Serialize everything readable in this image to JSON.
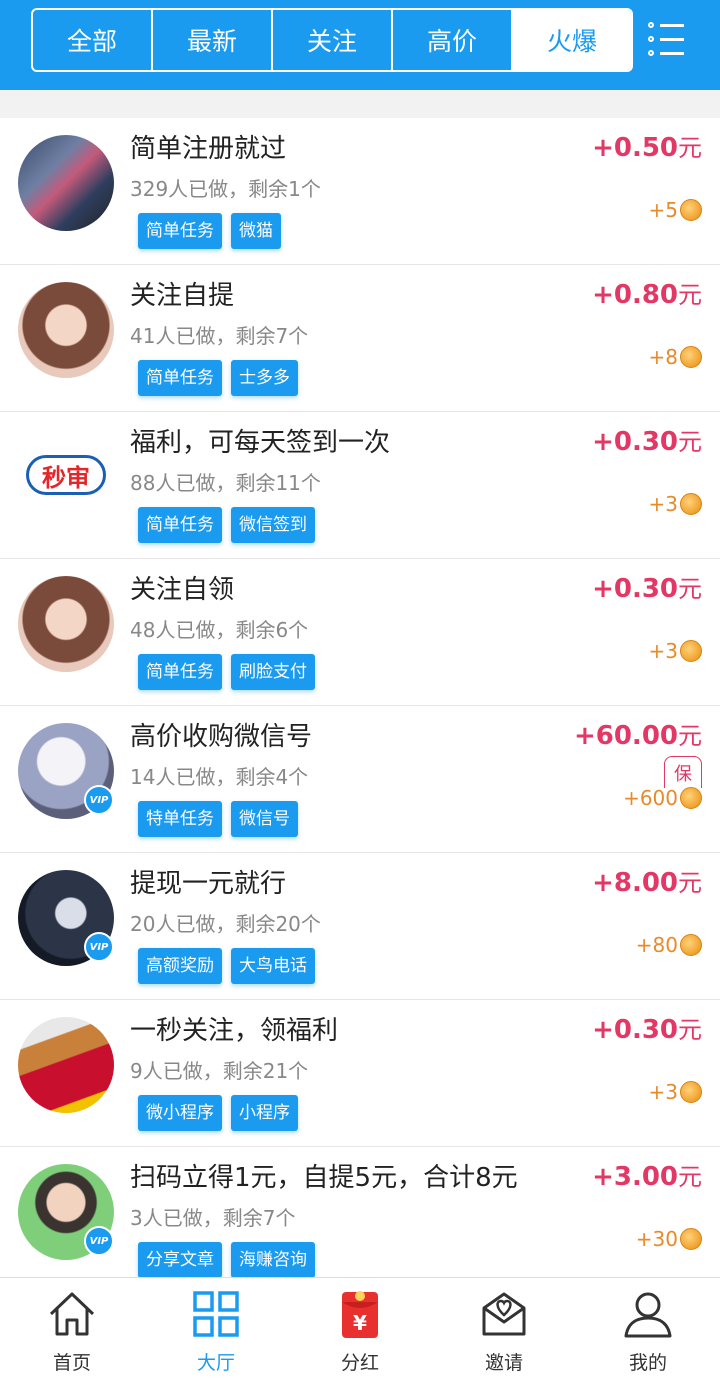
{
  "tabs": [
    {
      "label": "全部"
    },
    {
      "label": "最新"
    },
    {
      "label": "关注"
    },
    {
      "label": "高价"
    },
    {
      "label": "火爆"
    }
  ],
  "active_tab": 4,
  "menu_icon": "list-menu-icon",
  "colors": {
    "brand": "#1a9bf0",
    "price": "#e33766",
    "coin": "#e88a2a"
  },
  "tasks": [
    {
      "title": "简单注册就过",
      "meta": "329人已做，剩余1个",
      "tags": [
        "简单任务",
        "微猫"
      ],
      "price": "+0.50",
      "unit": "元",
      "coins": "+5",
      "vip": false,
      "avatar": "game-screenshot"
    },
    {
      "title": "关注自提",
      "meta": "41人已做，剩余7个",
      "tags": [
        "简单任务",
        "士多多"
      ],
      "price": "+0.80",
      "unit": "元",
      "coins": "+8",
      "vip": false,
      "avatar": "girl-portrait"
    },
    {
      "title": "福利，可每天签到一次",
      "meta": "88人已做，剩余11个",
      "tags": [
        "简单任务",
        "微信签到"
      ],
      "price": "+0.30",
      "unit": "元",
      "coins": "+3",
      "vip": false,
      "avatar": "miaoshen-logo",
      "logo_text": "秒审"
    },
    {
      "title": "关注自领",
      "meta": "48人已做，剩余6个",
      "tags": [
        "简单任务",
        "刷脸支付"
      ],
      "price": "+0.30",
      "unit": "元",
      "coins": "+3",
      "vip": false,
      "avatar": "girl-portrait"
    },
    {
      "title": "高价收购微信号",
      "meta": "14人已做，剩余4个",
      "tags": [
        "特单任务",
        "微信号"
      ],
      "price": "+60.00",
      "unit": "元",
      "coins": "+600",
      "vip": true,
      "badge": "保",
      "avatar": "rabbit-hat"
    },
    {
      "title": "提现一元就行",
      "meta": "20人已做，剩余20个",
      "tags": [
        "高额奖励",
        "大鸟电话"
      ],
      "price": "+8.00",
      "unit": "元",
      "coins": "+80",
      "vip": true,
      "avatar": "anime-dark"
    },
    {
      "title": "一秒关注，领福利",
      "meta": "9人已做，剩余21个",
      "tags": [
        "微小程序",
        "小程序"
      ],
      "price": "+0.30",
      "unit": "元",
      "coins": "+3",
      "vip": false,
      "avatar": "fries-photo"
    },
    {
      "title": "扫码立得1元，自提5元，合计8元",
      "meta": "3人已做，剩余7个",
      "tags": [
        "分享文章",
        "海赚咨询"
      ],
      "price": "+3.00",
      "unit": "元",
      "coins": "+30",
      "vip": true,
      "avatar": "man-portrait"
    }
  ],
  "vip_label": "VIP",
  "bottom_nav": [
    {
      "label": "首页",
      "icon": "home-icon"
    },
    {
      "label": "大厅",
      "icon": "grid-icon"
    },
    {
      "label": "分红",
      "icon": "red-envelope-icon",
      "symbol": "¥"
    },
    {
      "label": "邀请",
      "icon": "invite-icon"
    },
    {
      "label": "我的",
      "icon": "user-icon"
    }
  ],
  "active_nav": 1
}
